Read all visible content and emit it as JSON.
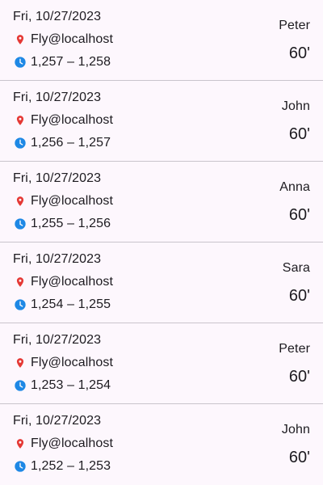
{
  "colors": {
    "background": "#FDF7FD",
    "divider": "#C9C4CC",
    "location_icon": "#E53935",
    "time_icon": "#1E88E5",
    "text": "#1D1B20"
  },
  "icons": {
    "location": "location-pin-icon",
    "time": "clock-icon"
  },
  "entries": [
    {
      "date": "Fri, 10/27/2023",
      "location": "Fly@localhost",
      "range": "1,257 – 1,258",
      "person": "Peter",
      "duration": "60'"
    },
    {
      "date": "Fri, 10/27/2023",
      "location": "Fly@localhost",
      "range": "1,256 – 1,257",
      "person": "John",
      "duration": "60'"
    },
    {
      "date": "Fri, 10/27/2023",
      "location": "Fly@localhost",
      "range": "1,255 – 1,256",
      "person": "Anna",
      "duration": "60'"
    },
    {
      "date": "Fri, 10/27/2023",
      "location": "Fly@localhost",
      "range": "1,254 – 1,255",
      "person": "Sara",
      "duration": "60'"
    },
    {
      "date": "Fri, 10/27/2023",
      "location": "Fly@localhost",
      "range": "1,253 – 1,254",
      "person": "Peter",
      "duration": "60'"
    },
    {
      "date": "Fri, 10/27/2023",
      "location": "Fly@localhost",
      "range": "1,252 – 1,253",
      "person": "John",
      "duration": "60'"
    }
  ]
}
